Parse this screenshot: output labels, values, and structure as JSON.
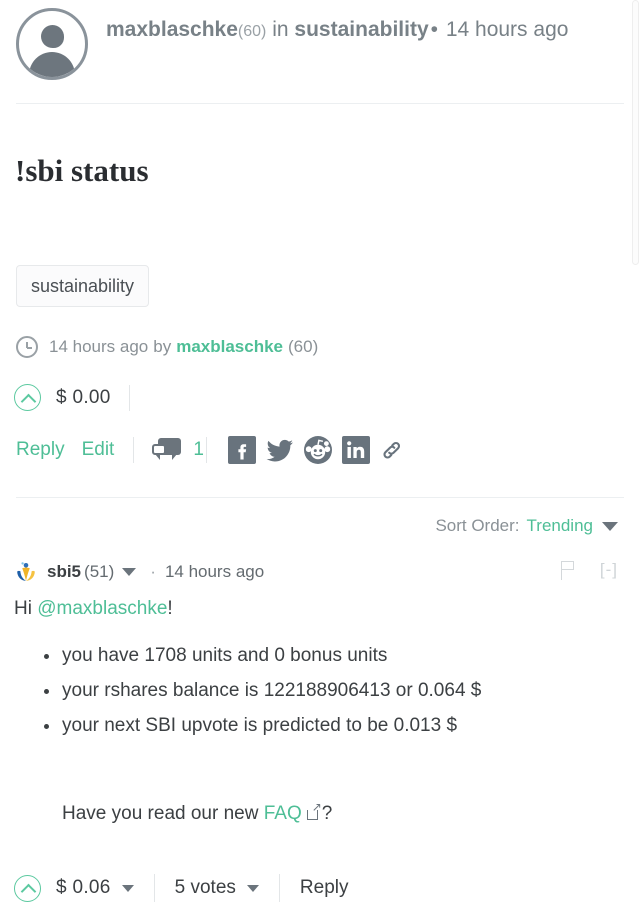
{
  "post": {
    "author": "maxblaschke",
    "author_reputation": "(60)",
    "in_label": "in",
    "community": "sustainability",
    "separator_dot": "•",
    "age": "14 hours ago",
    "title": "!sbi status",
    "tags": [
      "sustainability"
    ],
    "meta": {
      "age": "14 hours ago",
      "by_label": "by",
      "author": "maxblaschke",
      "author_reputation": "(60)"
    },
    "payout": "$ 0.00",
    "actions": {
      "reply": "Reply",
      "edit": "Edit",
      "comment_count": "1",
      "share_targets": [
        "facebook-icon",
        "twitter-icon",
        "reddit-icon",
        "linkedin-icon",
        "link-icon"
      ]
    }
  },
  "sort": {
    "label": "Sort Order:",
    "value": "Trending"
  },
  "comment": {
    "author": "sbi5",
    "author_reputation": "(51)",
    "separator_dot": "·",
    "age": "14 hours ago",
    "collapse_toggle": "[-]",
    "greeting_prefix": "Hi ",
    "greeting_mention": "@maxblaschke",
    "greeting_suffix": "!",
    "bullets": [
      "you have 1708 units and 0 bonus units",
      "your rshares balance is 122188906413 or 0.064 $",
      "your next SBI upvote is predicted to be 0.013 $"
    ],
    "faq_prefix": "Have you read our new ",
    "faq_link": "FAQ",
    "faq_suffix": "?",
    "payout": "$ 0.06",
    "votes": "5 votes",
    "reply": "Reply"
  },
  "colors": {
    "accent_green": "#4ebe96",
    "upvote_green": "#5cc9a0",
    "text_primary": "#3c4043",
    "text_muted": "#8a9196",
    "icon_gray": "#6b747c",
    "divider": "#eceff1"
  }
}
